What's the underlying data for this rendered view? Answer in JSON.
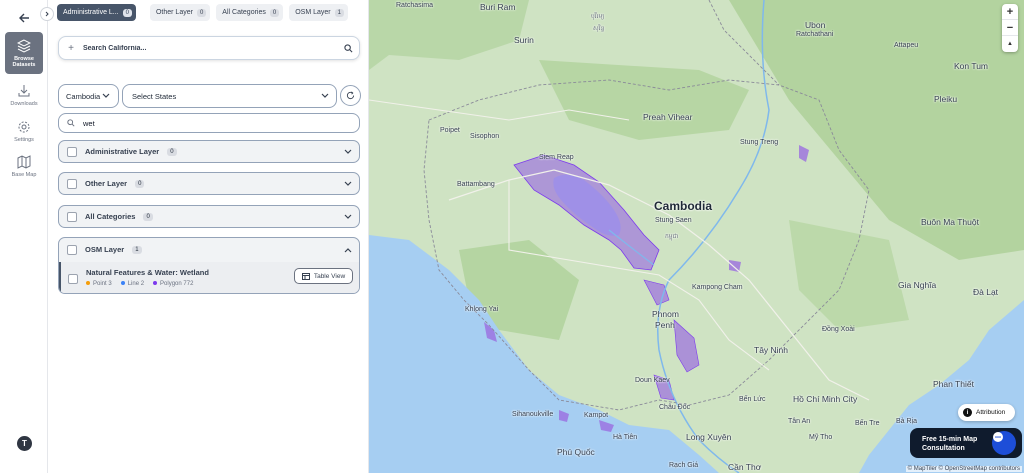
{
  "rail": {
    "items": [
      {
        "label": "Browse Datasets",
        "icon": "layers-icon"
      },
      {
        "label": "Downloads",
        "icon": "download-icon"
      },
      {
        "label": "Settings",
        "icon": "gear-icon"
      },
      {
        "label": "Base Map",
        "icon": "map-icon"
      }
    ],
    "avatar": "T"
  },
  "tabs": [
    {
      "label": "Administrative L...",
      "count": "0"
    },
    {
      "label": "Other Layer",
      "count": "0"
    },
    {
      "label": "All Categories",
      "count": "0"
    },
    {
      "label": "OSM Layer",
      "count": "1"
    }
  ],
  "search": {
    "placeholder": "Search California..."
  },
  "country": {
    "value": "Cambodia"
  },
  "states": {
    "placeholder": "Select States"
  },
  "filter": {
    "value": "wet"
  },
  "sections": [
    {
      "label": "Administrative Layer",
      "count": "0"
    },
    {
      "label": "Other Layer",
      "count": "0"
    },
    {
      "label": "All Categories",
      "count": "0"
    }
  ],
  "osm": {
    "label": "OSM Layer",
    "count": "1",
    "layer": {
      "title": "Natural Features & Water: Wetland",
      "legend": [
        {
          "label": "Point 3",
          "color": "#f59e0b"
        },
        {
          "label": "Line 2",
          "color": "#3b82f6"
        },
        {
          "label": "Polygon 772",
          "color": "#7c3aed"
        }
      ],
      "table_button": "Table View"
    }
  },
  "map": {
    "labels": {
      "ratchasima": "Ratchasima",
      "buri_ram": "Buri Ram",
      "khmer_buri_ram": "បុរីរម្យ",
      "surin": "Surin",
      "khmer_surin": "សុរិន្ទ",
      "ubon": "Ubon",
      "ubon2": "Ratchathani",
      "attapeu": "Attapeu",
      "kon_tum": "Kon Tum",
      "pleiku": "Pleiku",
      "poipet": "Poipet",
      "sisophon": "Sisophon",
      "preah_vihear": "Preah Vihear",
      "stung_treng": "Stung Treng",
      "siem_reap": "Siem Reap",
      "battambang": "Battambang",
      "cambodia": "Cambodia",
      "khmer_cambodia": "កម្ពុជា",
      "stung_saen": "Stung Saen",
      "buon_ma_thuot": "Buôn Ma Thuột",
      "kampong_cham": "Kampong Cham",
      "gia_nghia": "Gia Nghĩa",
      "da_lat": "Đà Lạt",
      "khlong_yai": "Khlong Yai",
      "phnom_penh1": "Phnom",
      "phnom_penh2": "Penh",
      "dong_xoai": "Đồng Xoài",
      "tay_ninh": "Tây Ninh",
      "phan_thiet": "Phan Thiết",
      "doun_kaev": "Doun Kaev",
      "sihanoukville": "Sihanoukville",
      "kampot": "Kampot",
      "chau_doc": "Châu Đốc",
      "ho_chi_minh": "Hồ Chí Minh City",
      "long_xuyen": "Long Xuyên",
      "ha_tien": "Hà Tiên",
      "tan_an": "Tân An",
      "phu_quoc": "Phú Quốc",
      "can_tho": "Cần Thơ",
      "rach_gia": "Rạch Giá",
      "my_tho": "Mỹ Tho",
      "ben_tre": "Bến Tre",
      "ba_ria": "Bà Rịa",
      "ben_luc": "Bến Lức"
    },
    "zoom_in": "+",
    "zoom_out": "−",
    "compass": "▲",
    "attribution": "Attribution",
    "consult": "Free 15-min Map Consultation",
    "credits": "© MapTiler © OpenStreetMap contributors",
    "colors": {
      "wetland": "#9b6ee0",
      "water": "#a6cef2",
      "land": "#cfe3c3"
    }
  }
}
